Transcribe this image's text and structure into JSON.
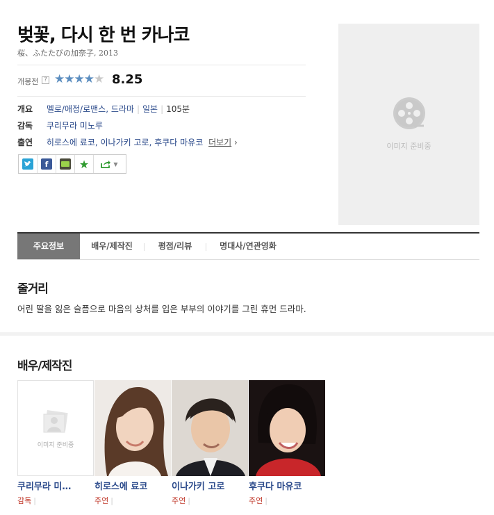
{
  "movie": {
    "title": "벚꽃, 다시 한 번 카나코",
    "subtitle": "桜、ふたたびの加奈子, 2013",
    "rating_label": "개봉전",
    "rating_help": "?",
    "score": "8.25",
    "stars_filled": 4,
    "stars_total": 5
  },
  "info": {
    "overview_label": "개요",
    "genre": "멜로/애정/로맨스, 드라마",
    "country": "일본",
    "runtime": "105분",
    "director_label": "감독",
    "director": "쿠리무라 미노루",
    "cast_label": "출연",
    "cast": "히로스에 료코, 이나가키 고로, 후쿠다 마유코",
    "more": "더보기",
    "more_arrow": "›"
  },
  "share": [
    {
      "name": "twitter",
      "color": "#2aa3d6"
    },
    {
      "name": "facebook",
      "color": "#3b5998"
    },
    {
      "name": "me2day",
      "color": "#5a5a5a"
    },
    {
      "name": "bookmark",
      "color": "#2e9a2e"
    }
  ],
  "poster": {
    "placeholder": "이미지 준비중"
  },
  "tabs": [
    "주요정보",
    "배우/제작진",
    "평점/리뷰",
    "명대사/연관영화"
  ],
  "synopsis": {
    "heading": "줄거리",
    "text": "어린 딸을 잃은 슬픔으로 마음의 상처를 입은 부부의 이야기를 그린 휴먼 드라마."
  },
  "cast_section": {
    "heading": "배우/제작진",
    "placeholder": "이미지 준비중",
    "people": [
      {
        "name": "쿠리무라 미…",
        "role": "감독"
      },
      {
        "name": "히로스에 료코",
        "role": "주연"
      },
      {
        "name": "이나가키 고로",
        "role": "주연"
      },
      {
        "name": "후쿠다 마유코",
        "role": "주연"
      }
    ]
  }
}
